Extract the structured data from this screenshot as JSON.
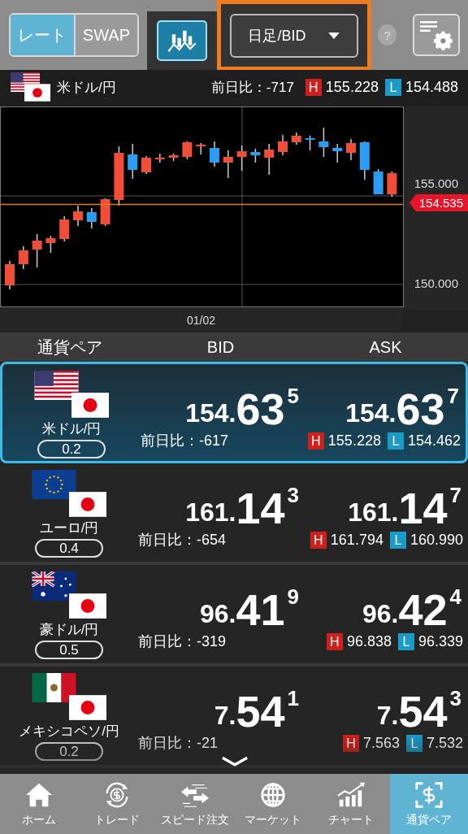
{
  "toolbar": {
    "view_tabs": [
      {
        "label": "レート",
        "selected": true
      },
      {
        "label": "SWAP",
        "selected": false
      }
    ],
    "chart_toggle": {
      "on": true
    },
    "period_dropdown": {
      "value": "日足/BID",
      "highlighted": true
    },
    "help": "?"
  },
  "summary": {
    "pair": "米ドル/円",
    "change": "前日比：-717",
    "high_label": "H",
    "high": "155.228",
    "low_label": "L",
    "low": "154.488"
  },
  "chart": {
    "price_labels": [
      "155.000",
      "150.000"
    ],
    "current_price": "154.535",
    "date_label": "01/02"
  },
  "columns": [
    "通貨ペア",
    "BID",
    "ASK"
  ],
  "pairs": [
    {
      "name": "米ドル/円",
      "spread": "0.2",
      "selected": true,
      "bid": {
        "prefix": "154.",
        "big": "63",
        "pip": "5"
      },
      "ask": {
        "prefix": "154.",
        "big": "63",
        "pip": "7"
      },
      "change": "前日比：-617",
      "high_label": "H",
      "high": "155.228",
      "low_label": "L",
      "low": "154.462"
    },
    {
      "name": "ユーロ/円",
      "spread": "0.4",
      "selected": false,
      "bid": {
        "prefix": "161.",
        "big": "14",
        "pip": "3"
      },
      "ask": {
        "prefix": "161.",
        "big": "14",
        "pip": "7"
      },
      "change": "前日比：-654",
      "high_label": "H",
      "high": "161.794",
      "low_label": "L",
      "low": "160.990"
    },
    {
      "name": "豪ドル/円",
      "spread": "0.5",
      "selected": false,
      "bid": {
        "prefix": "96.",
        "big": "41",
        "pip": "9"
      },
      "ask": {
        "prefix": "96.",
        "big": "42",
        "pip": "4"
      },
      "change": "前日比：-319",
      "high_label": "H",
      "high": "96.838",
      "low_label": "L",
      "low": "96.339"
    },
    {
      "name": "メキシコペソ/円",
      "spread": "0.2",
      "selected": false,
      "bid": {
        "prefix": "7.",
        "big": "54",
        "pip": "1"
      },
      "ask": {
        "prefix": "7.",
        "big": "54",
        "pip": "3"
      },
      "change": "前日比：-21",
      "high_label": "H",
      "high": "7.563",
      "low_label": "L",
      "low": "7.532"
    }
  ],
  "nav": [
    {
      "label": "ホーム",
      "selected": false
    },
    {
      "label": "トレード",
      "selected": false
    },
    {
      "label": "スピード注文",
      "selected": false
    },
    {
      "label": "マーケット",
      "selected": false
    },
    {
      "label": "チャート",
      "selected": false
    },
    {
      "label": "通貨ペア",
      "selected": true
    }
  ]
}
